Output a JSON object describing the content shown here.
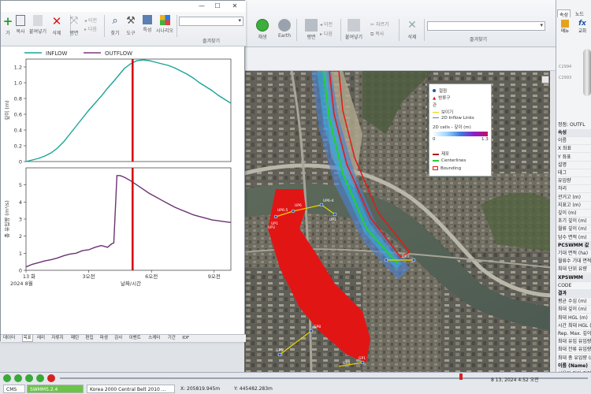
{
  "main_toolbar": {
    "buttons": [
      {
        "label": "채생",
        "icon": "play-icon"
      },
      {
        "label": "Earth",
        "icon": "earth-icon"
      },
      {
        "label": "평면",
        "icon": "plane-icon"
      },
      {
        "label": "이전",
        "icon": "prev-icon"
      },
      {
        "label": "다음",
        "icon": "next-icon"
      },
      {
        "label": "붙여넣기",
        "icon": "paste-icon"
      },
      {
        "label": "자르기",
        "icon": "cut-icon"
      },
      {
        "label": "복사",
        "icon": "copy-icon"
      },
      {
        "label": "삭제",
        "icon": "delete-icon"
      }
    ],
    "favorites_group_label": "즐겨찾기"
  },
  "graph_window": {
    "window_controls": {
      "minimize": "—",
      "maximize": "☐",
      "close": "✕"
    },
    "toolbar": {
      "buttons": [
        {
          "label": "가",
          "icon": "new-icon"
        },
        {
          "label": "복사",
          "icon": "copy-icon"
        },
        {
          "label": "붙여넣기",
          "icon": "paste-icon"
        },
        {
          "label": "삭제",
          "icon": "delete-icon"
        },
        {
          "label": "평면",
          "icon": "plane-icon"
        },
        {
          "label": "이전",
          "icon": "prev-icon"
        },
        {
          "label": "다음",
          "icon": "next-icon"
        },
        {
          "label": "찾기",
          "icon": "binoculars-icon"
        },
        {
          "label": "도구",
          "icon": "tools-icon"
        },
        {
          "label": "특성",
          "icon": "properties-icon"
        },
        {
          "label": "시나리오",
          "icon": "scenario-icon"
        }
      ],
      "favorites_label": "즐겨찾기"
    },
    "tabs": [
      "데이터",
      "목표",
      "레리",
      "자류지",
      "패턴",
      "편집",
      "파생",
      "감사",
      "이벤트",
      "스케터",
      "기간",
      "IDF"
    ],
    "active_tab": "목표"
  },
  "chart_data": [
    {
      "type": "line",
      "series": [
        {
          "name": "INFLOW",
          "color": "#1aa39a"
        },
        {
          "name": "OUTFLOW",
          "color": "#7b3a7e"
        }
      ],
      "ylabel": "깊이 (m)",
      "ylim": [
        0,
        1.3
      ],
      "yticks": [
        "0",
        "0.2",
        "0.4",
        "0.6",
        "0.8",
        "1.0",
        "1.2"
      ],
      "x": [
        0.0,
        0.3,
        0.6,
        0.9,
        1.2,
        1.5,
        1.8,
        2.1,
        2.4,
        2.7,
        3.0,
        3.3,
        3.6,
        3.9,
        4.2,
        4.45,
        4.7,
        5.0,
        5.3,
        5.6,
        5.9,
        6.2,
        6.5,
        6.8,
        7.1,
        7.4,
        7.7,
        8.0,
        8.3,
        8.6,
        8.9,
        9.2,
        9.5,
        9.8
      ],
      "values": [
        0.0,
        0.02,
        0.04,
        0.07,
        0.11,
        0.17,
        0.25,
        0.35,
        0.45,
        0.55,
        0.65,
        0.74,
        0.83,
        0.93,
        1.02,
        1.1,
        1.18,
        1.24,
        1.28,
        1.29,
        1.28,
        1.26,
        1.24,
        1.22,
        1.19,
        1.15,
        1.11,
        1.06,
        1.0,
        0.95,
        0.9,
        0.84,
        0.79,
        0.74
      ],
      "marker_x": 5.1,
      "marker_color": "#d40000"
    },
    {
      "type": "line",
      "series": [
        {
          "name": "OUTFLOW",
          "color": "#6a3372"
        }
      ],
      "ylabel": "총 유입량 (m³/s)",
      "ylim": [
        0,
        6
      ],
      "yticks": [
        "0",
        "1",
        "2",
        "3",
        "4",
        "5"
      ],
      "x": [
        0.0,
        0.3,
        0.6,
        0.9,
        1.2,
        1.5,
        1.8,
        2.1,
        2.4,
        2.7,
        3.0,
        3.3,
        3.6,
        3.9,
        4.1,
        4.2,
        4.35,
        4.5,
        4.7,
        5.0,
        5.3,
        5.6,
        5.9,
        6.2,
        6.5,
        6.8,
        7.1,
        7.4,
        7.7,
        8.0,
        8.3,
        8.6,
        8.9,
        9.2,
        9.5,
        9.8
      ],
      "values": [
        0.2,
        0.35,
        0.45,
        0.55,
        0.62,
        0.72,
        0.85,
        0.95,
        1.0,
        1.15,
        1.2,
        1.35,
        1.45,
        1.35,
        1.55,
        1.6,
        5.55,
        5.55,
        5.45,
        5.25,
        5.0,
        4.75,
        4.5,
        4.3,
        4.1,
        3.9,
        3.7,
        3.55,
        3.4,
        3.25,
        3.15,
        3.05,
        2.95,
        2.9,
        2.85,
        2.8
      ],
      "xticks": [
        {
          "x": 0.0,
          "top": "13",
          "bottom": "2024 8월",
          "extra": "화"
        },
        {
          "x": 3.0,
          "top": "3오전",
          "bottom": ""
        },
        {
          "x": 6.0,
          "top": "6오전",
          "bottom": ""
        },
        {
          "x": 9.0,
          "top": "9오전",
          "bottom": ""
        }
      ],
      "xlabel": "날짜/시간",
      "marker_x": 5.1,
      "marker_color": "#d40000"
    }
  ],
  "legend": {
    "items": [
      {
        "label": "절점",
        "icon": "node-dot-icon"
      },
      {
        "label": "방류구",
        "icon": "outfall-icon"
      },
      {
        "label": "관",
        "icon": "conduit-icon"
      },
      {
        "label": "보이기",
        "icon": "weir-icon"
      },
      {
        "label": "2D Inflow Links",
        "icon": "inflow-link-icon"
      },
      {
        "label": "2D cells - 깊이 (m)",
        "icon": "depth-ramp-icon"
      },
      {
        "label": "0",
        "icon": ""
      },
      {
        "label": "1.3",
        "icon": ""
      },
      {
        "label": "제포",
        "icon": "levee-icon"
      },
      {
        "label": "Centerlines",
        "icon": "centerline-icon"
      },
      {
        "label": "Bounding",
        "icon": "bounding-icon"
      }
    ]
  },
  "properties_panel": {
    "tabs": [
      "속성",
      "노드"
    ],
    "tools": [
      {
        "label": "메뉴",
        "icon": "menu-icon"
      },
      {
        "label": "교회",
        "icon": "formula-icon"
      }
    ],
    "ids": [
      "C2994",
      "C2993"
    ],
    "title": "정점: OUTFL",
    "rows": [
      {
        "text": "속성",
        "header": true
      },
      {
        "text": "이름",
        "header": false
      },
      {
        "text": "X 좌표",
        "header": false
      },
      {
        "text": "Y 좌표",
        "header": false
      },
      {
        "text": "설명",
        "header": false
      },
      {
        "text": "태그",
        "header": false
      },
      {
        "text": "유입량",
        "header": false
      },
      {
        "text": "처리",
        "header": false
      },
      {
        "text": "관거고 (m)",
        "header": false
      },
      {
        "text": "지표고 (m)",
        "header": false
      },
      {
        "text": "깊이 (m)",
        "header": false
      },
      {
        "text": "초기 깊이 (m)",
        "header": false
      },
      {
        "text": "월류 깊이 (m)",
        "header": false
      },
      {
        "text": "담수 면적 (m)",
        "header": false
      },
      {
        "text": "PCSWMM 값",
        "header": true
      },
      {
        "text": "기대 면적 (ha)",
        "header": false
      },
      {
        "text": "월류수 기대 면적",
        "header": false
      },
      {
        "text": "최대 단위 유량",
        "header": false
      },
      {
        "text": "XPSWMM",
        "header": true
      },
      {
        "text": "CODE",
        "header": false
      },
      {
        "text": "결과",
        "header": true
      },
      {
        "text": "평균 수심 (m)",
        "header": false
      },
      {
        "text": "최대 깊이 (m)",
        "header": false
      },
      {
        "text": "최대 HGL (m)",
        "header": false
      },
      {
        "text": "시간 최대 HGL (m)",
        "header": false
      },
      {
        "text": "Rep. Max. 깊이",
        "header": false
      },
      {
        "text": "최대 유입 유입량",
        "header": false
      },
      {
        "text": "최대 잔류 유입량",
        "header": false
      },
      {
        "text": "최대 총 유입량 (m",
        "header": false
      },
      {
        "text": "이름 (Name)",
        "header": true
      },
      {
        "text": "사용자 정의 절점",
        "header": false
      }
    ]
  },
  "status": {
    "datetime": "8 13, 2024 4:52 오전",
    "cms": "CMS",
    "engine": "SWMM5.2.4",
    "projection": "Korea 2000 Central Belt 2010 ...",
    "x_coord": "X: 205819.945m",
    "y_coord": "Y: 445482.283m"
  },
  "map_labels": [
    "UP6-5",
    "UP6",
    "UP6-4",
    "UP2",
    "UP3",
    "UP1",
    "GP8",
    "GP5",
    "GP4",
    "GP1",
    "DP3"
  ]
}
